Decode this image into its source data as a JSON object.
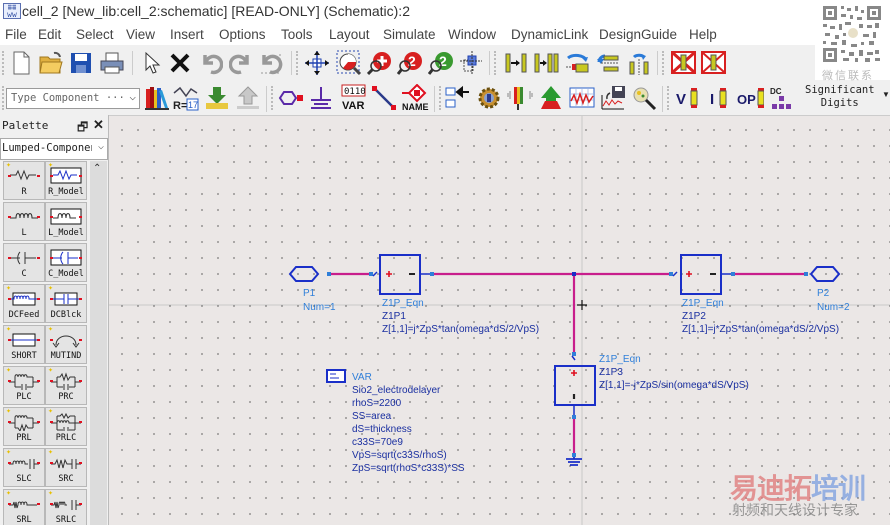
{
  "window": {
    "title": "cell_2 [New_lib:cell_2:schematic] [READ-ONLY] (Schematic):2",
    "app_icon": "ads-schematic-icon"
  },
  "menu": [
    "File",
    "Edit",
    "Select",
    "View",
    "Insert",
    "Options",
    "Tools",
    "Layout",
    "Simulate",
    "Window",
    "DynamicLink",
    "DesignGuide",
    "Help"
  ],
  "toolbar1": {
    "buttons": [
      "new-icon",
      "open-icon",
      "save-icon",
      "print-icon",
      "select-pointer-icon",
      "delete-icon",
      "undo-icon",
      "redo-icon",
      "undo-all-icon",
      "pan-icon",
      "zoom-view-all-icon",
      "zoom-in-icon",
      "zoom-in-2x-icon",
      "zoom-out-2x-icon",
      "zoom-point-icon",
      "push-into-hierarchy-icon",
      "pop-out-hierarchy-icon",
      "rotate-icon",
      "mirror-x-icon",
      "mirror-y-icon",
      "deactivate-icon",
      "short-deactivate-icon"
    ]
  },
  "toolbar2": {
    "type_component_placeholder": "Type Component",
    "type_component_ellipsis": "···",
    "buttons": [
      "library-browser-icon",
      "component-history-icon",
      "import-icon",
      "export-icon",
      "port-icon",
      "ground-icon",
      "var-icon",
      "wire-icon",
      "name-icon",
      "netlist-icon",
      "simulate-settings-icon",
      "tune-icon",
      "simulate-icon",
      "data-display-icon",
      "save-data-icon",
      "optimize-wand-icon",
      "voltage-annotation-icon",
      "current-annotation-icon",
      "op-annotation-icon",
      "dc-annotation-icon"
    ],
    "var_label": "VAR",
    "var_code": "0110",
    "name_label": "NAME",
    "r_label": "R=",
    "r_value": "17",
    "annotation_labels": {
      "v": "V",
      "i": "I",
      "op": "OP",
      "dc": "DC"
    },
    "significant_digits": [
      "Significant",
      "Digits"
    ]
  },
  "watermark_qr_label": "微信联系",
  "palette": {
    "title": "Palette",
    "library": "Lumped-Componen",
    "items": [
      "R",
      "R_Model",
      "L",
      "L_Model",
      "C",
      "C_Model",
      "DCFeed",
      "DCBlck",
      "SHORT",
      "MUTIND",
      "PLC",
      "PRC",
      "PRL",
      "PRLC",
      "SLC",
      "SRC",
      "SRL",
      "SRLC"
    ]
  },
  "schematic": {
    "ports": [
      {
        "name": "P1",
        "num": "Num=1"
      },
      {
        "name": "P2",
        "num": "Num=2"
      }
    ],
    "components": [
      {
        "type": "Z1P_Eqn",
        "name": "Z1P1",
        "eqn": "Z[1,1]=j*ZpS*tan(omega*dS/2/VpS)"
      },
      {
        "type": "Z1P_Eqn",
        "name": "Z1P2",
        "eqn": "Z[1,1]=j*ZpS*tan(omega*dS/2/VpS)"
      },
      {
        "type": "Z1P_Eqn",
        "name": "Z1P3",
        "eqn": "Z[1,1]=-j*ZpS/sin(omega*dS/VpS)"
      }
    ],
    "var_block": {
      "title": "VAR",
      "name": "Sio2_electrodelayer",
      "lines": [
        "rhoS=2200",
        "SS=area",
        "dS=thickness",
        "c33S=70e9",
        "VpS=sqrt(c33S/rhoS)",
        "ZpS=sqrt(rhoS*c33S)*SS"
      ]
    },
    "colors": {
      "wire": "#c81e8c",
      "component": "#1a2fc8",
      "label": "#2f7fd9",
      "label_dark": "#1a2fa0"
    }
  },
  "watermark": {
    "brand_red": "易迪拓",
    "brand_blue": "培训",
    "tagline": "射频和天线设计专家"
  }
}
